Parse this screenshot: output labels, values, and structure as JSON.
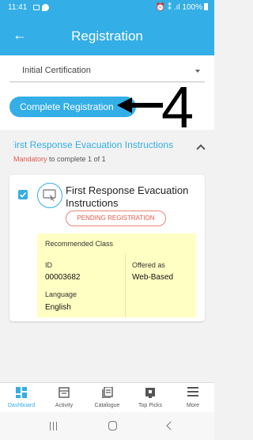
{
  "status_bar": {
    "time": "11:41",
    "right": "⏰ ⁑ .ıl 100%"
  },
  "appbar": {
    "back_icon": "←",
    "title": "Registration"
  },
  "certification_select": {
    "value": "Initial Certification"
  },
  "register_button": {
    "label": "Complete Registration"
  },
  "annotation": {
    "number": "4"
  },
  "section": {
    "title": "First Response Evacuation Instructions",
    "mandatory": "Mandatory",
    "progress": " to complete 1 of 1"
  },
  "course": {
    "title": "First Response Evacuation Instructions",
    "status": "PENDING REGISTRATION",
    "checked": true,
    "info": {
      "heading": "Recommended Class",
      "id_label": "ID",
      "id_value": "00003682",
      "offered_label": "Offered as",
      "offered_value": "Web-Based",
      "language_label": "Language",
      "language_value": "English"
    }
  },
  "nav": {
    "items": [
      {
        "label": "Dashboard",
        "icon": "dashboard-icon",
        "active": true
      },
      {
        "label": "Activity",
        "icon": "activity-icon",
        "active": false
      },
      {
        "label": "Catalogue",
        "icon": "catalogue-icon",
        "active": false
      },
      {
        "label": "Top Picks",
        "icon": "top-picks-icon",
        "active": false
      },
      {
        "label": "More",
        "icon": "menu-icon",
        "active": false
      }
    ]
  },
  "colors": {
    "primary": "#33aee6",
    "danger": "#e05a4e",
    "info_bg": "#ffffc4"
  }
}
